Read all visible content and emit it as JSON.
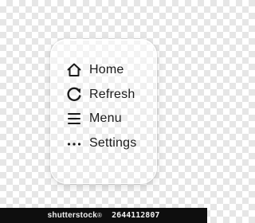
{
  "menu": {
    "items": [
      {
        "label": "Home",
        "icon": "home-icon"
      },
      {
        "label": "Refresh",
        "icon": "refresh-icon"
      },
      {
        "label": "Menu",
        "icon": "hamburger-icon"
      },
      {
        "label": "Settings",
        "icon": "more-horizontal-icon"
      }
    ]
  },
  "watermark": {
    "brand": "shutterstock",
    "trademark": "®",
    "id": "2644112807"
  },
  "colors": {
    "text": "#1a1a1a",
    "checker_light": "#ffffff",
    "checker_dark": "#e6e6e6",
    "watermark_bg": "#0e0e0e"
  }
}
